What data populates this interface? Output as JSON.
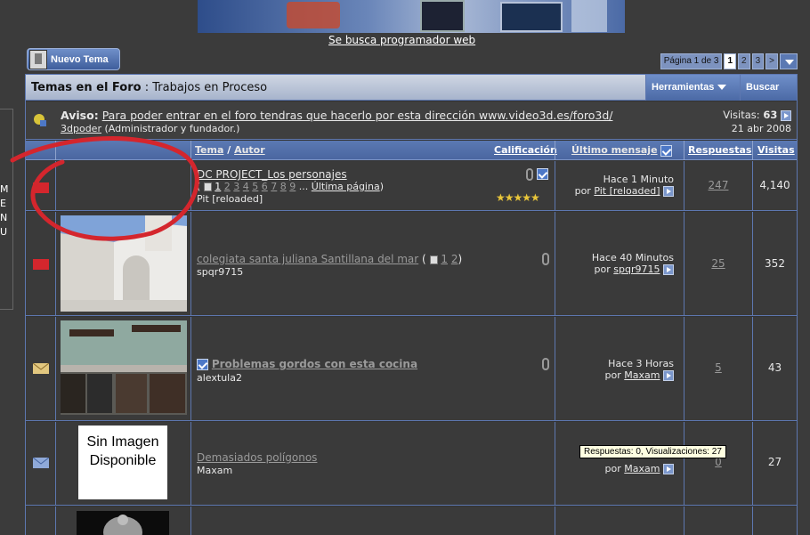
{
  "banner": {
    "link": "Se busca programador web"
  },
  "left_stub": {
    "letters": [
      "M",
      "E",
      "N",
      "U"
    ]
  },
  "new_topic": {
    "label": "Nuevo Tema"
  },
  "pager": {
    "info": "Página 1 de 3",
    "pages": [
      "1",
      "2",
      "3"
    ],
    "next": ">",
    "current": "1"
  },
  "forum": {
    "section": "Temas en el Foro",
    "forum_name": "Trabajos en Proceso",
    "tools_label": "Herramientas",
    "search_label": "Buscar"
  },
  "notice": {
    "label": "Aviso:",
    "text": "Para poder entrar en el foro tendras que hacerlo por esta dirección www.video3d.es/foro3d/",
    "author": "3dpoder",
    "author_role": "(Administrador y fundador.)",
    "visits_label": "Visitas:",
    "visits": "63",
    "date": "21 abr 2008"
  },
  "columns": {
    "topic": "Tema",
    "author": "Autor",
    "rating": "Calificación",
    "last_post": "Último mensaje",
    "replies": "Respuestas",
    "views": "Visitas"
  },
  "threads": [
    {
      "title": "DC PROJECT_Los personajes",
      "pages": [
        "1",
        "2",
        "3",
        "4",
        "5",
        "6",
        "7",
        "8",
        "9"
      ],
      "ellipsis": "...",
      "last_page": "Última página",
      "author": "Pit [reloaded]",
      "last_time": "Hace 1 Minuto",
      "by": "por",
      "last_user": "Pit [reloaded]",
      "replies": "247",
      "views": "4,140",
      "rating_stars": "★★★★★"
    },
    {
      "title": "colegiata santa juliana Santillana del mar",
      "pages": [
        "1",
        "2"
      ],
      "author": "spqr9715",
      "last_time": "Hace 40 Minutos",
      "by": "por",
      "last_user": "spqr9715",
      "replies": "25",
      "views": "352"
    },
    {
      "title": "Problemas gordos con esta cocina",
      "author": "alextula2",
      "last_time": "Hace 3 Horas",
      "by": "por",
      "last_user": "Maxam",
      "replies": "5",
      "views": "43"
    },
    {
      "title": "Demasiados polígonos",
      "author": "Maxam",
      "by": "por",
      "last_user": "Maxam",
      "replies": "0",
      "views": "27",
      "no_image": "Sin Imagen Disponible"
    }
  ],
  "tooltip": "Respuestas: 0, Visualizaciones: 27",
  "colors": {
    "accent": "#5b79b3",
    "row_bg": "#3a3a3a",
    "annotation": "#d4262d"
  }
}
